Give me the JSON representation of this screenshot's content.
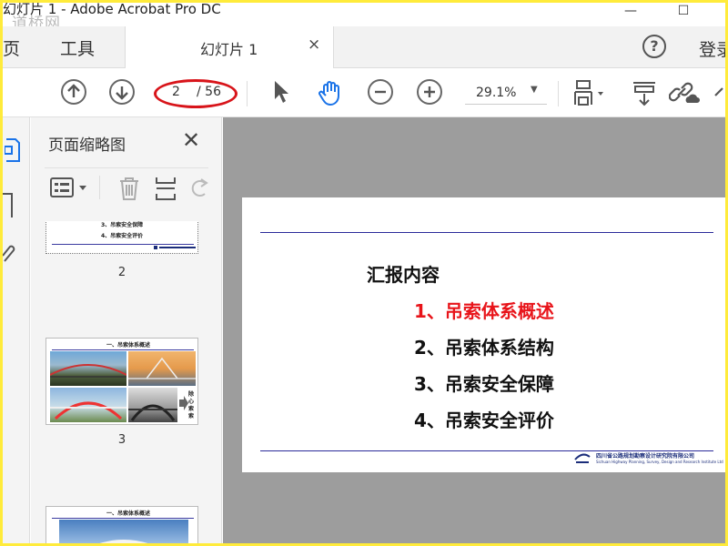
{
  "window": {
    "title": "幻灯片 1 - Adobe Acrobat Pro DC",
    "watermark": "道桥网",
    "minimize": "—",
    "maximize": "☐"
  },
  "tabs": {
    "home": "主页",
    "tools": "工具",
    "document": "幻灯片 1",
    "close": "×",
    "help": "?",
    "login": "登录"
  },
  "toolbar": {
    "prev_page_icon": "arrow-up-circle-icon",
    "next_page_icon": "arrow-down-circle-icon",
    "current_page": "2",
    "total_pages": "/ 56",
    "zoom": "29.1%",
    "zoom_caret": "▼",
    "icons": [
      "arrow-up-circle-icon",
      "arrow-down-circle-icon",
      "select-pointer-icon",
      "hand-tool-icon",
      "zoom-out-icon",
      "zoom-in-icon",
      "page-layout-icon",
      "scroll-mode-icon",
      "link-cloud-icon"
    ]
  },
  "thumbnails_panel": {
    "title": "页面缩略图",
    "close": "✕",
    "page2_num": "2",
    "page3_num": "3",
    "page2_line1": "3、吊索安全保障",
    "page2_line2": "4、吊索安全评价",
    "page3_title": "一、吊索体系概述",
    "page4_title": "一、吊索体系概述",
    "page3_side": "除\n心\n索\n索"
  },
  "slide": {
    "heading": "汇报内容",
    "items": [
      {
        "text": "1、吊索体系概述",
        "active": true
      },
      {
        "text": "2、吊索体系结构",
        "active": false
      },
      {
        "text": "3、吊索安全保障",
        "active": false
      },
      {
        "text": "4、吊索安全评价",
        "active": false
      }
    ],
    "logo_line1": "四川省公路规划勘察设计研究院有限公司",
    "logo_line2": "Sichuan Highway Planning, Survey, Design and Research Institute Ltd"
  },
  "colors": {
    "accent_red": "#d8141a",
    "slide_active": "#e8141a",
    "slide_rule": "#2a2a9a",
    "viewport_bg": "#9d9d9d",
    "frame_yellow": "#ffeb3b"
  }
}
